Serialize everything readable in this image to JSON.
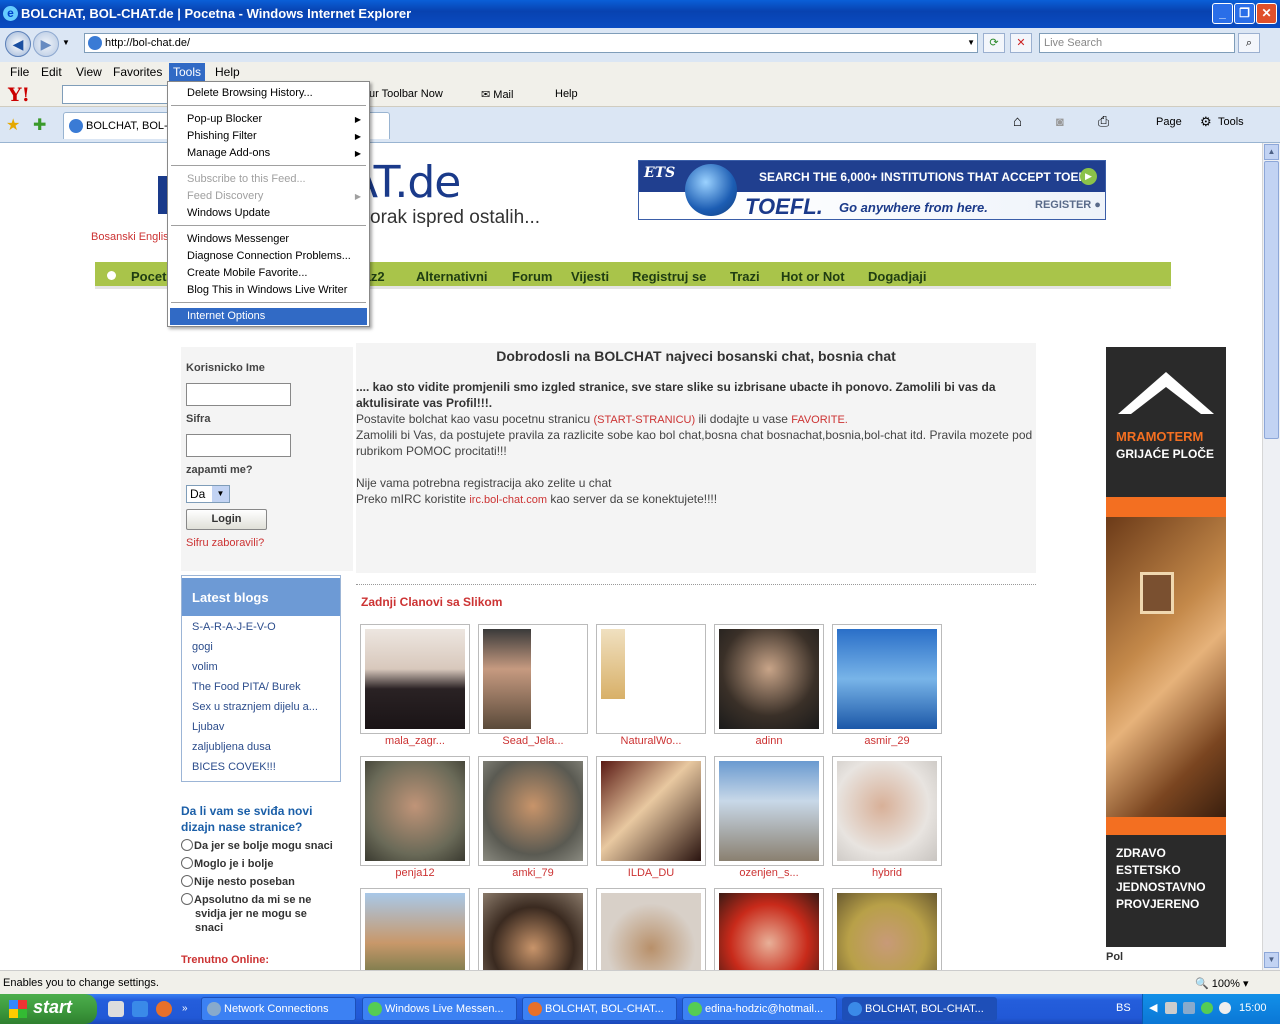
{
  "window": {
    "title": "BOLCHAT, BOL-CHAT.de | Pocetna - Windows Internet Explorer",
    "address": "http://bol-chat.de/",
    "search_placeholder": "Live Search"
  },
  "menubar": [
    "File",
    "Edit",
    "View",
    "Favorites",
    "Tools",
    "Help"
  ],
  "yahoo_toolbar": {
    "logo": "Y!",
    "items": [
      "ur Toolbar Now",
      "Mail",
      "Help"
    ]
  },
  "tab": {
    "label": "BOLCHAT, BOL-C"
  },
  "command_bar": [
    "Page",
    "Tools"
  ],
  "tools_menu": {
    "items": [
      {
        "label": "Delete Browsing History...",
        "state": "normal"
      },
      {
        "label": "Pop-up Blocker",
        "state": "submenu"
      },
      {
        "label": "Phishing Filter",
        "state": "submenu"
      },
      {
        "label": "Manage Add-ons",
        "state": "submenu"
      },
      {
        "label": "Subscribe to this Feed...",
        "state": "disabled"
      },
      {
        "label": "Feed Discovery",
        "state": "disabled-submenu"
      },
      {
        "label": "Windows Update",
        "state": "normal"
      },
      {
        "label": "Windows Messenger",
        "state": "normal"
      },
      {
        "label": "Diagnose Connection Problems...",
        "state": "normal"
      },
      {
        "label": "Create Mobile Favorite...",
        "state": "normal"
      },
      {
        "label": "Blog This in Windows Live Writer",
        "state": "normal"
      },
      {
        "label": "Internet Options",
        "state": "highlighted"
      }
    ]
  },
  "site": {
    "logo_text": "AT.de",
    "slogan": "orak ispred ostalih...",
    "lang": "Bosanski Englis",
    "nav": [
      "Pocet",
      "laz2",
      "Alternativni",
      "Forum",
      "Vijesti",
      "Registruj se",
      "Trazi",
      "Hot or Not",
      "Dogadjaji"
    ],
    "toefl_ad": {
      "ets": "ETS",
      "search": "SEARCH THE 6,000+ INSTITUTIONS THAT ACCEPT TOEFL",
      "brand": "TOEFL.",
      "tagline": "Go anywhere from here.",
      "register": "REGISTER"
    },
    "login": {
      "username_label": "Korisnicko Ime",
      "password_label": "Sifra",
      "remember_label": "zapamti me?",
      "remember_value": "Da",
      "login_button": "Login",
      "forgot_link": "Sifru zaboravili?"
    },
    "latest_blogs": {
      "title": "Latest blogs",
      "items": [
        "S-A-R-A-J-E-V-O",
        "gogi",
        "volim",
        "The Food PITA/ Burek",
        "Sex u straznjem dijelu a...",
        "Ljubav",
        "zaljubljena dusa",
        "BICES COVEK!!!"
      ]
    },
    "poll": {
      "question": "Da li vam se sviđa novi dizajn nase stranice?",
      "options": [
        "Da jer se bolje mogu snaci",
        "Moglo je i bolje",
        "Nije nesto poseban",
        "Apsolutno da mi se ne svidja jer ne mogu se snaci"
      ]
    },
    "online_label": "Trenutno Online:",
    "welcome": {
      "heading": "Dobrodosli na BOLCHAT najveci bosanski chat, bosnia chat",
      "bold": ".... kao sto vidite promjenili smo izgled stranice, sve stare slike su izbrisane ubacte ih ponovo. Zamolili bi vas da aktulisirate vas Profil!!!.",
      "p1_a": "Postavite bolchat kao vasu pocetnu stranicu ",
      "p1_link1": "(START-STRANICU)",
      "p1_b": " ili dodajte u vase ",
      "p1_link2": "FAVORITE.",
      "p2": "Zamolili bi Vas, da postujete pravila za razlicite sobe kao bol chat,bosna chat bosnachat,bosnia,bol-chat itd. Pravila mozete pod rubrikom POMOC procitati!!!",
      "p3": "Nije vama potrebna registracija ako zelite u chat",
      "p4_a": "Preko mIRC koristite ",
      "p4_link": "irc.bol-chat.com",
      "p4_b": " kao server da se konektujete!!!!"
    },
    "members_title": "Zadnji Clanovi sa Slikom",
    "members": [
      "mala_zagr...",
      "Sead_Jela...",
      "NaturalWo...",
      "adinn",
      "asmir_29",
      "penja12",
      "amki_79",
      "ILDA_DU",
      "ozenjen_s...",
      "hybrid"
    ],
    "right_ad": {
      "brand": "MRAMOTERM",
      "product": "GRIJAĆE PLOČE",
      "tagline": [
        "ZDRAVO",
        "ESTETSKO",
        "JEDNOSTAVNO",
        "PROVJERENO"
      ]
    },
    "pol_label": "Pol"
  },
  "statusbar": {
    "text": "Enables you to change settings.",
    "zoom": "100%"
  },
  "taskbar": {
    "start": "start",
    "tasks": [
      "Network Connections",
      "Windows Live Messen...",
      "BOLCHAT, BOL-CHAT...",
      "edina-hodzic@hotmail...",
      "BOLCHAT, BOL-CHAT..."
    ],
    "lang": "BS",
    "clock": "15:00"
  }
}
